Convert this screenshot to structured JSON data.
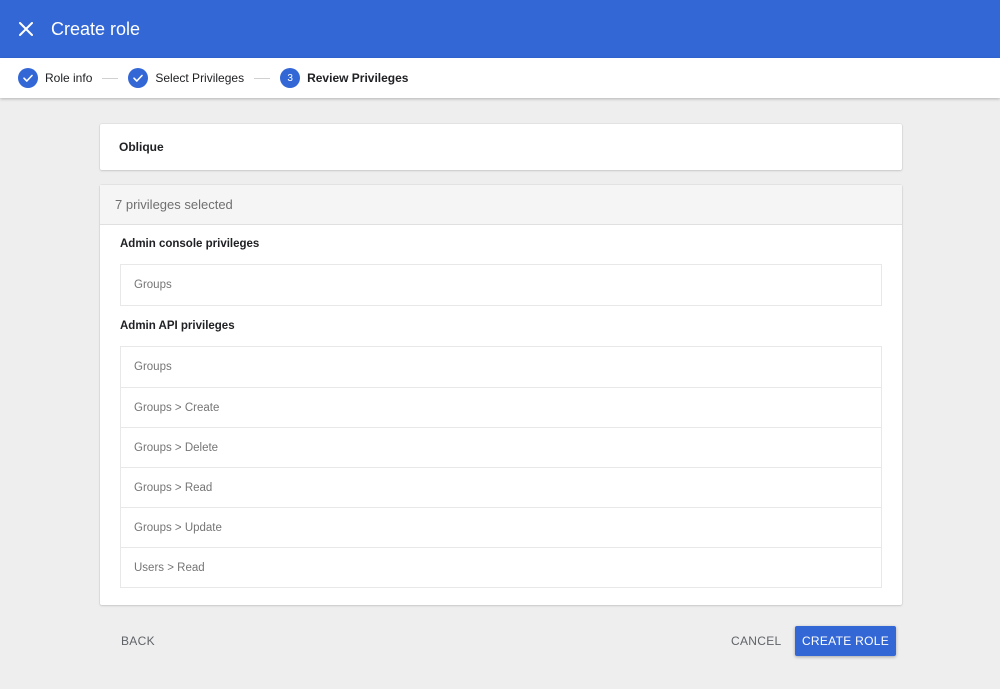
{
  "appbar": {
    "title": "Create role",
    "close_icon": "close-icon",
    "color": "#3367d6"
  },
  "stepper": {
    "steps": [
      {
        "label": "Role info",
        "status": "complete",
        "icon": "check-icon"
      },
      {
        "label": "Select Privileges",
        "status": "complete",
        "icon": "check-icon"
      },
      {
        "label": "Review Privileges",
        "status": "current",
        "number": "3"
      }
    ]
  },
  "role": {
    "name": "Oblique"
  },
  "privileges": {
    "summary": "7 privileges selected",
    "sections": [
      {
        "title": "Admin console privileges",
        "items": [
          "Groups"
        ]
      },
      {
        "title": "Admin API privileges",
        "items": [
          "Groups",
          "Groups > Create",
          "Groups > Delete",
          "Groups > Read",
          "Groups > Update",
          "Users > Read"
        ]
      }
    ]
  },
  "footer": {
    "back_label": "BACK",
    "cancel_label": "CANCEL",
    "create_label": "CREATE ROLE"
  }
}
